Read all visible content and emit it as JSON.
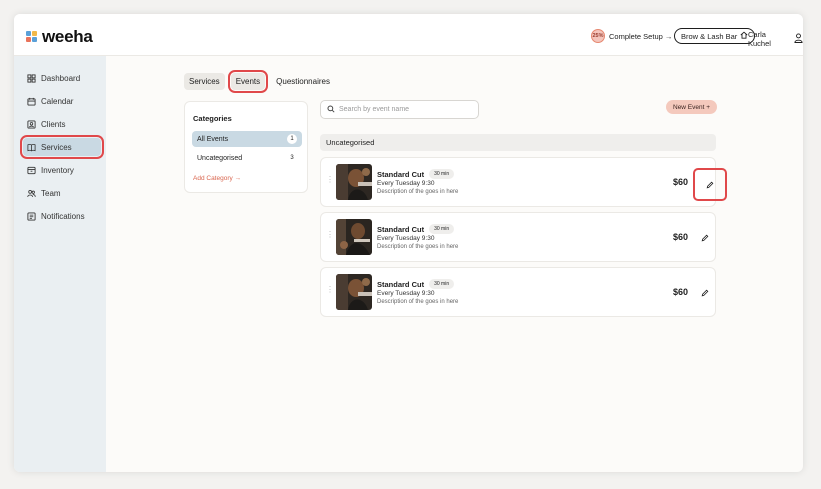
{
  "colors": {
    "accent": "#e0484a",
    "nav_active": "#c9d9e3",
    "sidebar_bg": "#eaeff2",
    "new_event_bg": "#f4c9bd"
  },
  "brand": {
    "name": "weeha"
  },
  "header": {
    "setup_percent": "25%",
    "setup_label": "Complete Setup →",
    "business_label": "Brow & Lash Bar",
    "business_icon": "home-icon",
    "user_name": "Carla Kuchel",
    "user_icon": "user-icon"
  },
  "sidebar": {
    "items": [
      {
        "label": "Dashboard",
        "icon": "grid-icon"
      },
      {
        "label": "Calendar",
        "icon": "calendar-icon"
      },
      {
        "label": "Clients",
        "icon": "contact-icon"
      },
      {
        "label": "Services",
        "icon": "book-icon",
        "active": true
      },
      {
        "label": "Inventory",
        "icon": "box-icon"
      },
      {
        "label": "Team",
        "icon": "team-icon"
      },
      {
        "label": "Notifications",
        "icon": "bell-icon"
      }
    ]
  },
  "tabs": {
    "services": "Services",
    "events": "Events",
    "questionnaires": "Questionnaires",
    "active": "Events"
  },
  "categories": {
    "title": "Categories",
    "items": [
      {
        "label": "All Events",
        "count": "1"
      },
      {
        "label": "Uncategorised",
        "count": "3"
      }
    ],
    "add_label": "Add Category →"
  },
  "search": {
    "placeholder": "Search by event name"
  },
  "new_event_label": "New Event +",
  "group_title": "Uncategorised",
  "events": [
    {
      "name": "Standard Cut",
      "duration": "30 min",
      "schedule": "Every Tuesday 9:30",
      "description": "Description of the  goes in here",
      "price": "$60"
    },
    {
      "name": "Standard Cut",
      "duration": "30 min",
      "schedule": "Every Tuesday 9:30",
      "description": "Description of the  goes in here",
      "price": "$60"
    },
    {
      "name": "Standard Cut",
      "duration": "30 min",
      "schedule": "Every Tuesday 9:30",
      "description": "Description of the  goes in here",
      "price": "$60"
    }
  ]
}
